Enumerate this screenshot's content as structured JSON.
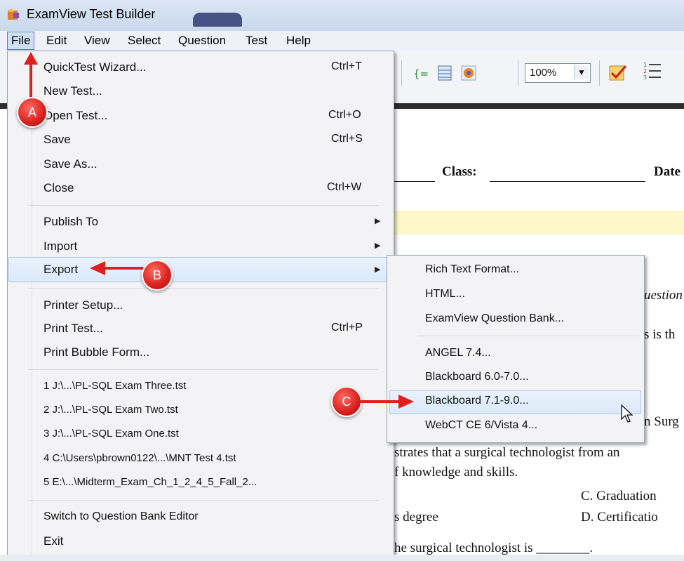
{
  "window": {
    "title": "ExamView Test Builder"
  },
  "menubar": {
    "items": [
      "File",
      "Edit",
      "View",
      "Select",
      "Question",
      "Test",
      "Help"
    ]
  },
  "toolbar": {
    "zoom": "100%"
  },
  "document": {
    "class_label": "Class:",
    "date_label": "Date",
    "lines": [
      "uestion",
      "s is th",
      "n Surg",
      "strates that a surgical technologist from an",
      "f knowledge and skills.",
      "C.  Graduation",
      "s degree",
      "D.  Certificatio",
      "he surgical technologist is ________."
    ]
  },
  "file_menu": {
    "items": [
      {
        "label": "QuickTest Wizard...",
        "shortcut": "Ctrl+T"
      },
      {
        "label": "New Test...",
        "shortcut": ""
      },
      {
        "label": "Open Test...",
        "shortcut": "Ctrl+O"
      },
      {
        "label": "Save",
        "shortcut": "Ctrl+S"
      },
      {
        "label": "Save As...",
        "shortcut": ""
      },
      {
        "label": "Close",
        "shortcut": "Ctrl+W"
      },
      {
        "label": "Publish To",
        "shortcut": ""
      },
      {
        "label": "Import",
        "shortcut": ""
      },
      {
        "label": "Export",
        "shortcut": ""
      },
      {
        "label": "Printer Setup...",
        "shortcut": ""
      },
      {
        "label": "Print Test...",
        "shortcut": "Ctrl+P"
      },
      {
        "label": "Print Bubble Form...",
        "shortcut": ""
      },
      {
        "label": "1 J:\\...\\PL-SQL Exam Three.tst",
        "shortcut": ""
      },
      {
        "label": "2 J:\\...\\PL-SQL Exam Two.tst",
        "shortcut": ""
      },
      {
        "label": "3 J:\\...\\PL-SQL Exam One.tst",
        "shortcut": ""
      },
      {
        "label": "4 C:\\Users\\pbrown0122\\...\\MNT Test 4.tst",
        "shortcut": ""
      },
      {
        "label": "5 E:\\...\\Midterm_Exam_Ch_1_2_4_5_Fall_2...",
        "shortcut": ""
      },
      {
        "label": "Switch to Question Bank Editor",
        "shortcut": ""
      },
      {
        "label": "Exit",
        "shortcut": ""
      }
    ]
  },
  "export_submenu": {
    "items": [
      "Rich Text Format...",
      "HTML...",
      "ExamView Question Bank...",
      "ANGEL 7.4...",
      "Blackboard 6.0-7.0...",
      "Blackboard 7.1-9.0...",
      "WebCT CE 6/Vista 4..."
    ],
    "highlighted": "Blackboard 7.1-9.0..."
  },
  "annotations": {
    "a": "A",
    "b": "B",
    "c": "C"
  },
  "colors": {
    "annotation_red": "#e0201e",
    "highlight": "#dbe9fa"
  }
}
